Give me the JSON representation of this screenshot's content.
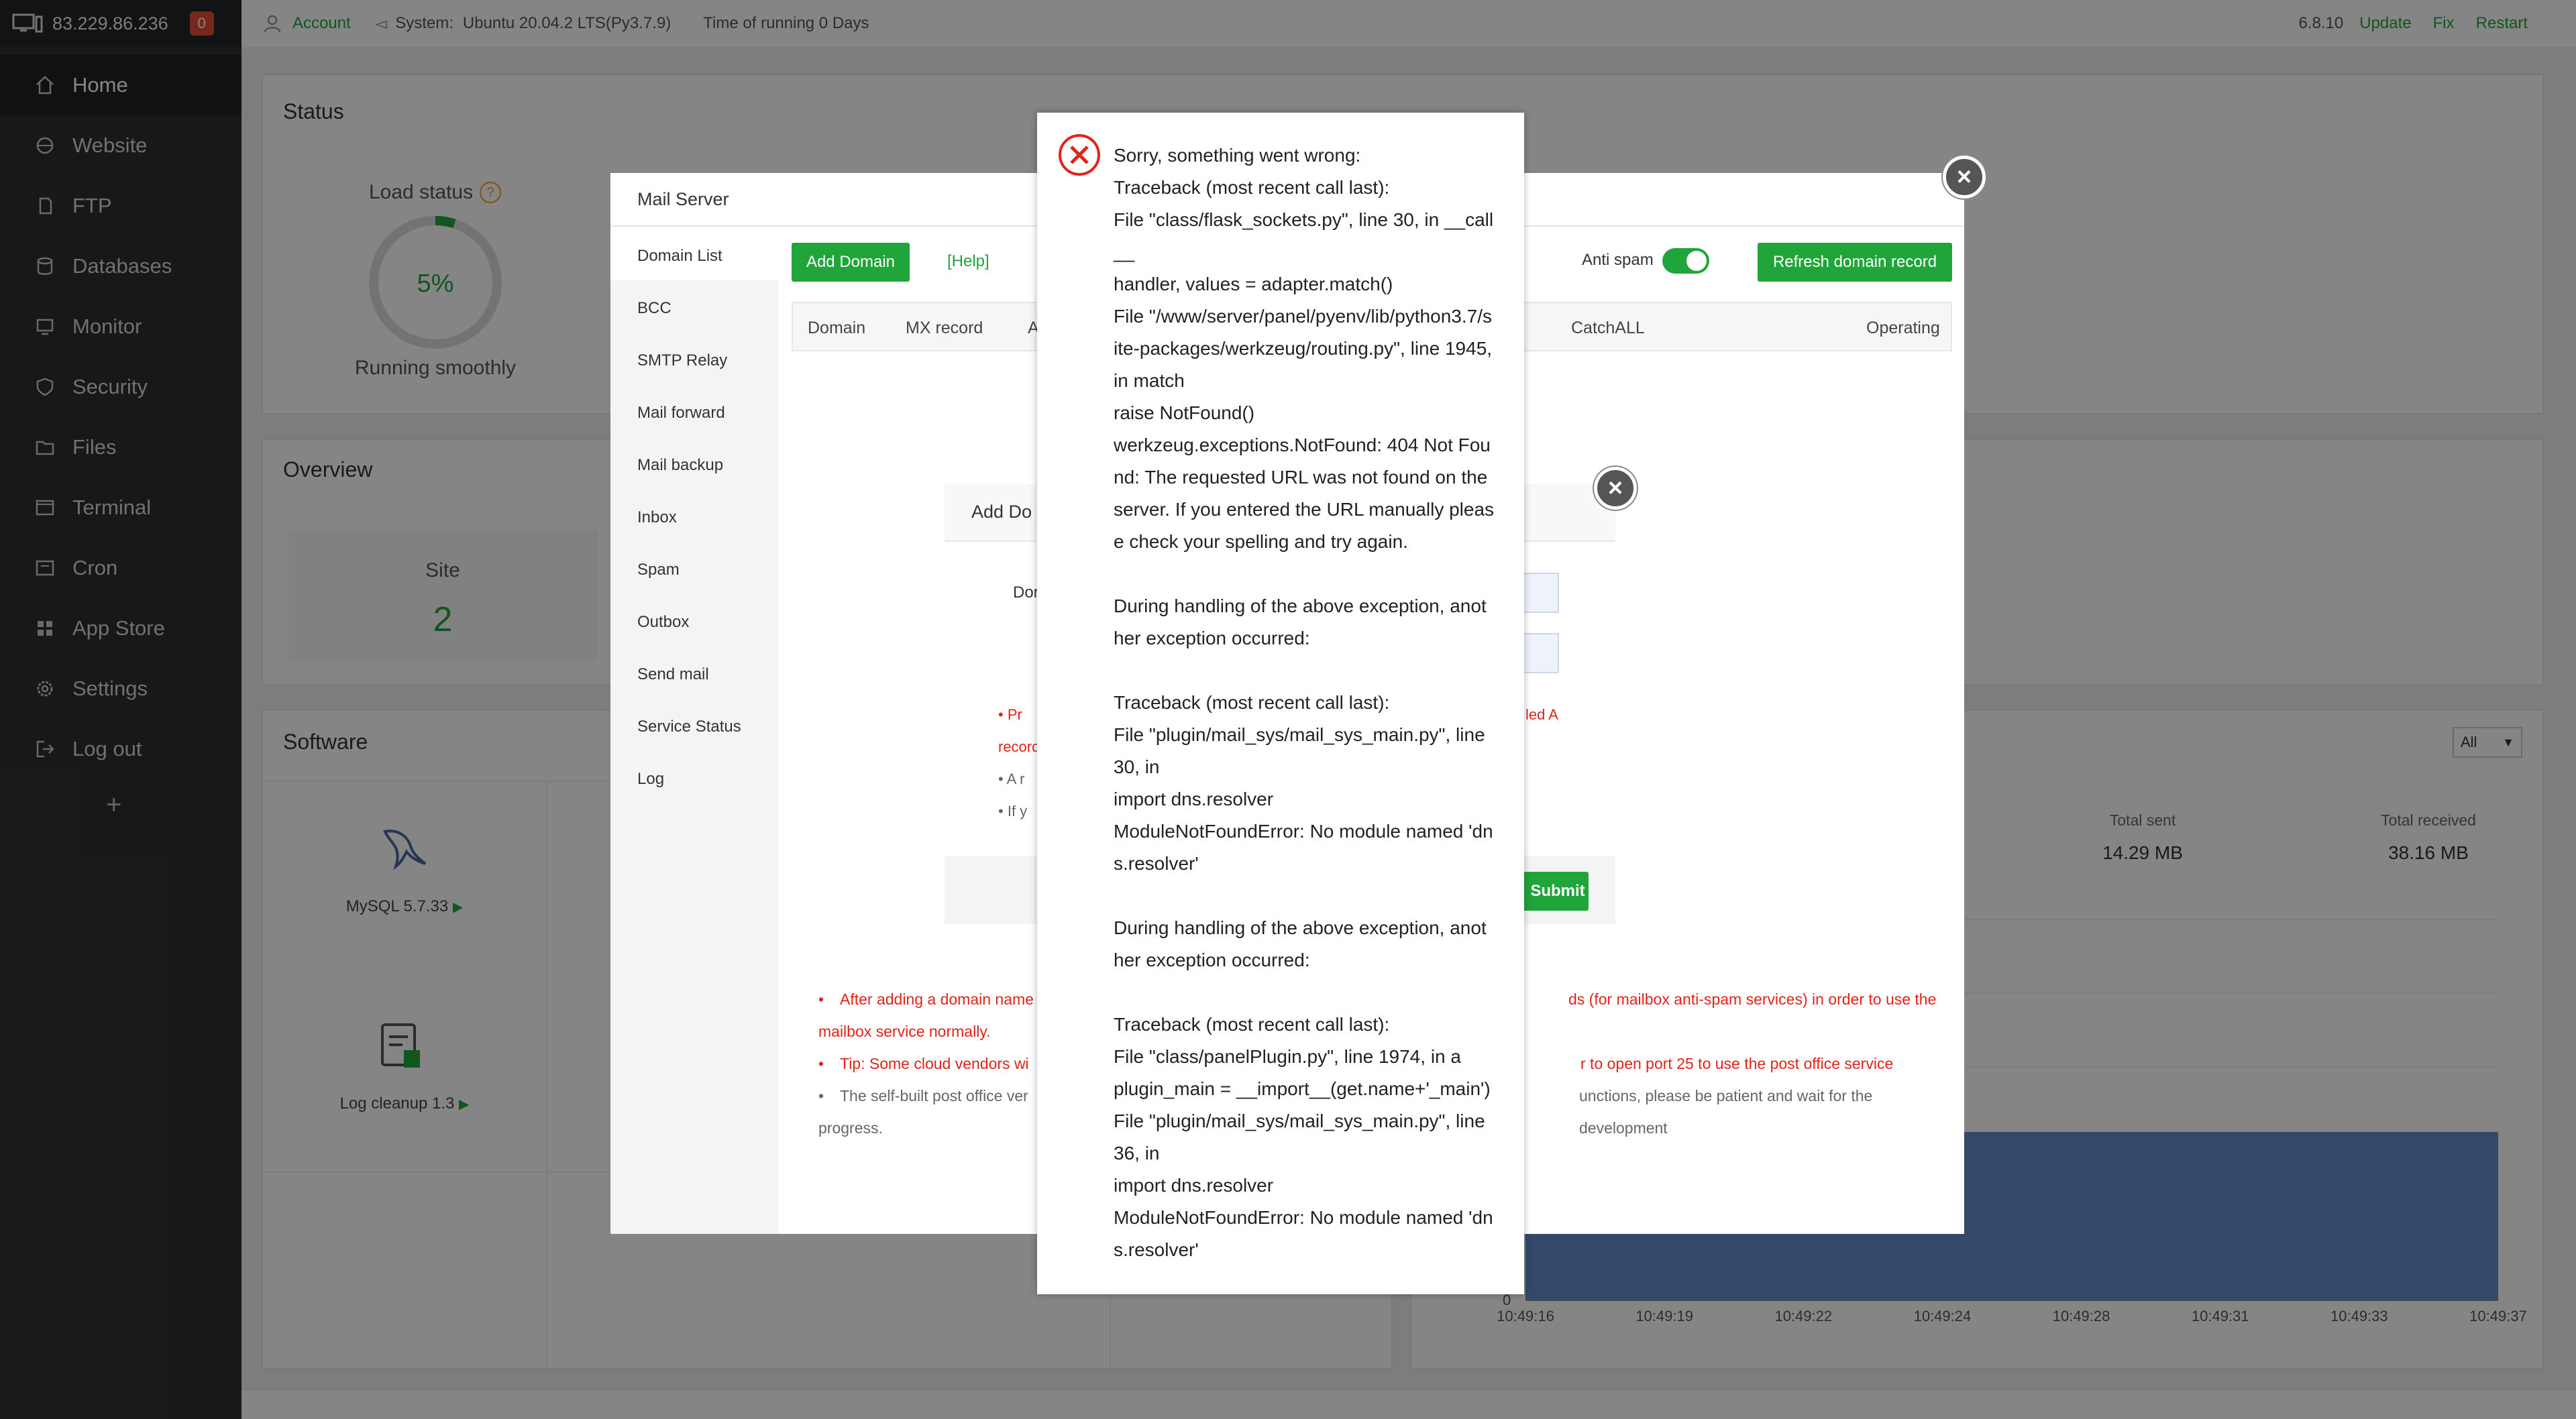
{
  "topbar": {
    "ip": "83.229.86.236",
    "notify_count": "0",
    "account": "Account",
    "system_label": "System:",
    "system_value": "Ubuntu 20.04.2 LTS(Py3.7.9)",
    "uptime": "Time of running 0 Days",
    "version": "6.8.10",
    "update": "Update",
    "fix": "Fix",
    "restart": "Restart"
  },
  "sidebar": {
    "items": [
      {
        "label": "Home",
        "icon": "home-icon"
      },
      {
        "label": "Website",
        "icon": "globe-icon"
      },
      {
        "label": "FTP",
        "icon": "ftp-icon"
      },
      {
        "label": "Databases",
        "icon": "database-icon"
      },
      {
        "label": "Monitor",
        "icon": "monitor-icon"
      },
      {
        "label": "Security",
        "icon": "shield-icon"
      },
      {
        "label": "Files",
        "icon": "folder-icon"
      },
      {
        "label": "Terminal",
        "icon": "terminal-icon"
      },
      {
        "label": "Cron",
        "icon": "cron-icon"
      },
      {
        "label": "App Store",
        "icon": "app-store-icon"
      },
      {
        "label": "Settings",
        "icon": "gear-icon"
      },
      {
        "label": "Log out",
        "icon": "logout-icon"
      }
    ],
    "add": "+"
  },
  "status": {
    "title": "Status",
    "load_label": "Load status",
    "load_value": "5%",
    "load_fraction": 0.05,
    "load_text": "Running smoothly"
  },
  "overview": {
    "title": "Overview",
    "site_label": "Site",
    "site_value": "2"
  },
  "software": {
    "title": "Software",
    "mysql": "MySQL 5.7.33",
    "logcleanup": "Log cleanup 1.3",
    "filter": "All",
    "total_sent_label": "Total sent",
    "total_sent_value": "14.29 MB",
    "total_received_label": "Total received",
    "total_received_value": "38.16 MB",
    "chart_zero": "0",
    "times": [
      "10:49:16",
      "10:49:19",
      "10:49:22",
      "10:49:24",
      "10:49:28",
      "10:49:31",
      "10:49:33",
      "10:49:37"
    ]
  },
  "mail": {
    "title": "Mail Server",
    "nav": [
      "Domain List",
      "BCC",
      "SMTP Relay",
      "Mail forward",
      "Mail backup",
      "Inbox",
      "Spam",
      "Outbox",
      "Send mail",
      "Service Status",
      "Log"
    ],
    "add_domain": "Add Domain",
    "help": "[Help]",
    "anti_spam": "Anti spam",
    "refresh": "Refresh domain record",
    "cols": {
      "domain": "Domain",
      "mx": "MX record",
      "a": "A",
      "catchall": "CatchALL",
      "operating": "Operating"
    },
    "note1a": "After adding a domain name",
    "note1b": "ds (for mailbox anti-spam services) in order to use the",
    "note1c": "mailbox service normally.",
    "note2a": "Tip: Some cloud vendors wi",
    "note2b": "r to open port 25 to use the post office service",
    "note3a": "The self-built post office ver",
    "note3b": "unctions, please be patient and wait for the development",
    "note3c": "progress."
  },
  "adddom": {
    "title": "Add Do",
    "label": "Dor",
    "red1": "Pr",
    "red1b": "record",
    "red1r": "led A",
    "g1": "A r",
    "g2": "If y",
    "submit": "Submit"
  },
  "error": {
    "lines": [
      "Sorry, something went wrong:",
      "Traceback (most recent call last):",
      "File \"class/flask_sockets.py\", line 30, in __call",
      "__",
      "handler, values = adapter.match()",
      "File \"/www/server/panel/pyenv/lib/python3.7/s",
      "ite-packages/werkzeug/routing.py\", line 1945,",
      "in match",
      "raise NotFound()",
      "werkzeug.exceptions.NotFound: 404 Not Fou",
      "nd: The requested URL was not found on the",
      "server. If you entered the URL manually pleas",
      "e check your spelling and try again.",
      "",
      "During handling of the above exception, anot",
      "her exception occurred:",
      "",
      "Traceback (most recent call last):",
      "File \"plugin/mail_sys/mail_sys_main.py\", line",
      "30, in",
      "import dns.resolver",
      "ModuleNotFoundError: No module named 'dn",
      "s.resolver'",
      "",
      "During handling of the above exception, anot",
      "her exception occurred:",
      "",
      "Traceback (most recent call last):",
      "File \"class/panelPlugin.py\", line 1974, in a",
      "plugin_main = __import__(get.name+'_main')",
      "File \"plugin/mail_sys/mail_sys_main.py\", line",
      "36, in",
      "import dns.resolver",
      "ModuleNotFoundError: No module named 'dn",
      "s.resolver'"
    ]
  }
}
